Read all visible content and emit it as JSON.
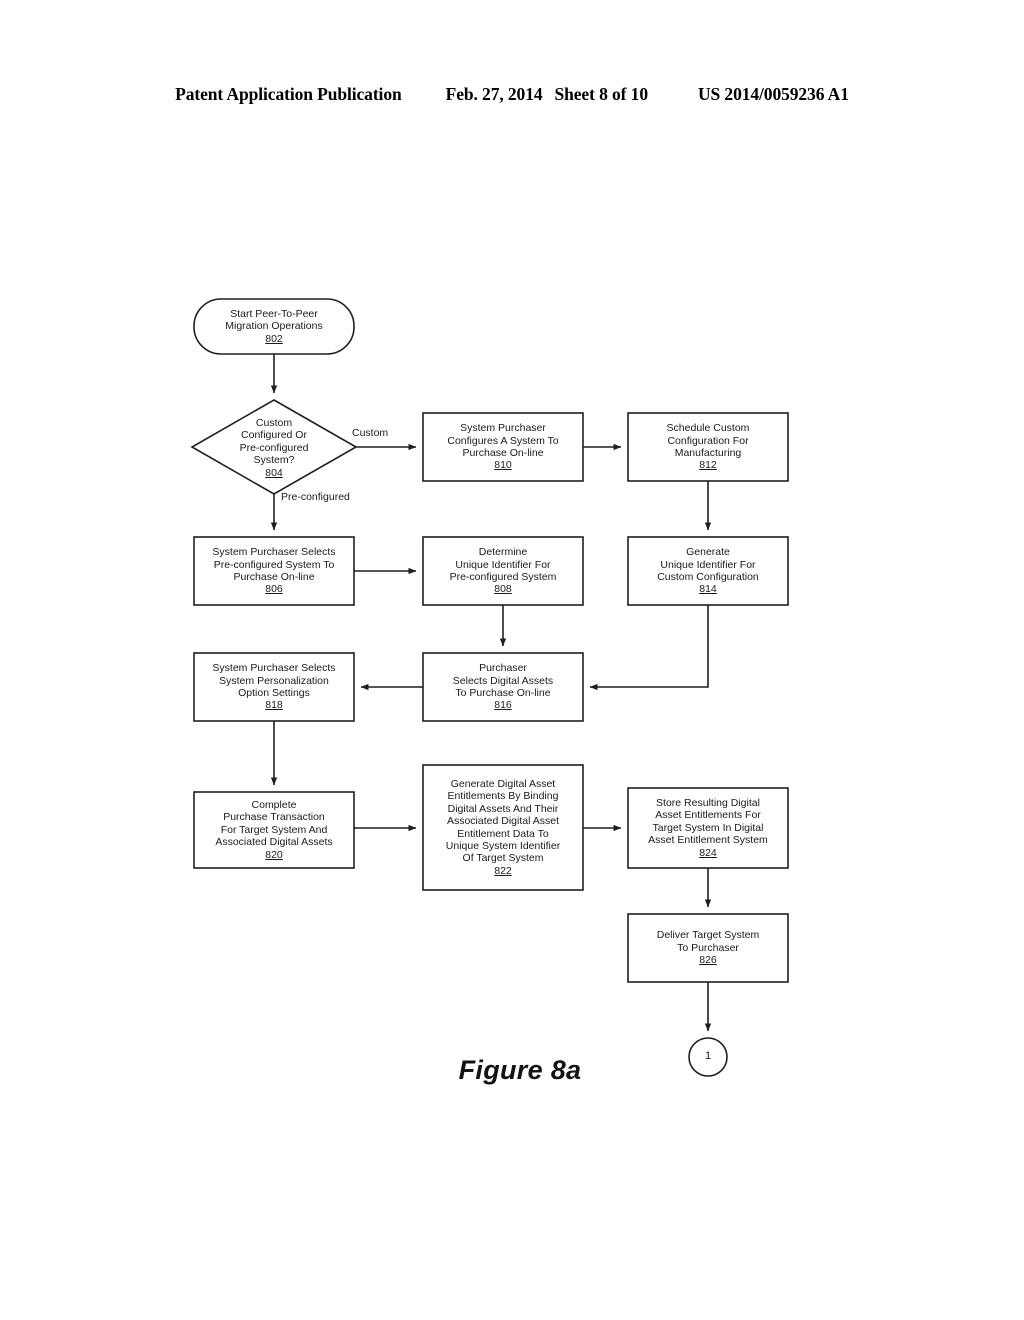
{
  "header": {
    "publication": "Patent Application Publication",
    "date": "Feb. 27, 2014",
    "sheet": "Sheet 8 of 10",
    "publication_number": "US 2014/0059236 A1"
  },
  "figure": {
    "caption": "Figure 8a"
  },
  "nodes": {
    "n802": {
      "shape": "rounded-terminator",
      "lines": [
        "Start Peer-To-Peer",
        "Migration Operations"
      ],
      "ref": "802"
    },
    "n804": {
      "shape": "diamond",
      "lines": [
        "Custom",
        "Configured Or",
        "Pre-configured",
        "System?"
      ],
      "ref": "804"
    },
    "n806": {
      "shape": "rect",
      "lines": [
        "System Purchaser Selects",
        "Pre-configured System To",
        "Purchase On-line"
      ],
      "ref": "806"
    },
    "n808": {
      "shape": "rect",
      "lines": [
        "Determine",
        "Unique Identifier For",
        "Pre-configured System"
      ],
      "ref": "808"
    },
    "n810": {
      "shape": "rect",
      "lines": [
        "System Purchaser",
        "Configures A System To",
        "Purchase On-line"
      ],
      "ref": "810"
    },
    "n812": {
      "shape": "rect",
      "lines": [
        "Schedule Custom",
        "Configuration For",
        "Manufacturing"
      ],
      "ref": "812"
    },
    "n814": {
      "shape": "rect",
      "lines": [
        "Generate",
        "Unique Identifier For",
        "Custom Configuration"
      ],
      "ref": "814"
    },
    "n816": {
      "shape": "rect",
      "lines": [
        "Purchaser",
        "Selects Digital Assets",
        "To Purchase On-line"
      ],
      "ref": "816"
    },
    "n818": {
      "shape": "rect",
      "lines": [
        "System Purchaser Selects",
        "System Personalization",
        "Option Settings"
      ],
      "ref": "818"
    },
    "n820": {
      "shape": "rect",
      "lines": [
        "Complete",
        "Purchase Transaction",
        "For Target System And",
        "Associated Digital Assets"
      ],
      "ref": "820"
    },
    "n822": {
      "shape": "rect",
      "lines": [
        "Generate Digital Asset",
        "Entitlements By Binding",
        "Digital Assets And Their",
        "Associated Digital Asset",
        "Entitlement Data To",
        "Unique System Identifier",
        "Of Target System"
      ],
      "ref": "822"
    },
    "n824": {
      "shape": "rect",
      "lines": [
        "Store Resulting Digital",
        "Asset Entitlements For",
        "Target System In Digital",
        "Asset Entitlement System"
      ],
      "ref": "824"
    },
    "n826": {
      "shape": "rect",
      "lines": [
        "Deliver Target System",
        "To Purchaser"
      ],
      "ref": "826"
    },
    "connector1": {
      "shape": "circle",
      "label": "1"
    }
  },
  "edge_labels": {
    "custom": "Custom",
    "preconfigured": "Pre-configured"
  },
  "colors": {
    "stroke": "#1f1f1f",
    "text": "#1b1b1b",
    "background": "#ffffff"
  }
}
